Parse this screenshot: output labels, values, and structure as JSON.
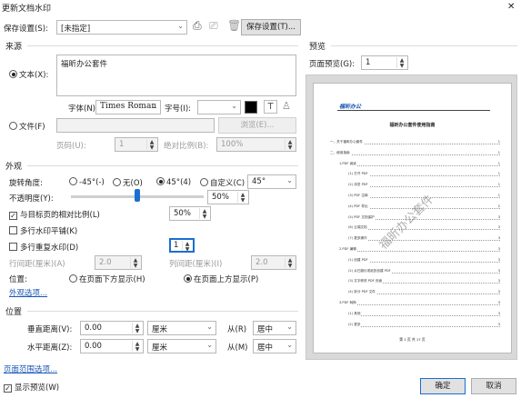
{
  "window": {
    "title": "更新文档水印",
    "close": "✕"
  },
  "saved": {
    "label": "保存设置(S):",
    "value": "[未指定]",
    "save_button": "保存设置(T)..."
  },
  "source": {
    "section": "来源",
    "text_radio": "文本(X):",
    "text_value": "福昕办公套件",
    "font_label": "字体(N):",
    "font_value": "Times Roman",
    "size_label": "字号(I):",
    "size_value": "",
    "file_radio": "文件(F)",
    "browse_button": "浏览(E)...",
    "page_label": "页码(U):",
    "page_value": "1",
    "abs_scale_label": "绝对比例(B):",
    "abs_scale_value": "100%"
  },
  "appearance": {
    "section": "外观",
    "rotation_label": "旋转角度:",
    "rot_options": [
      "-45°(-)",
      "无(O)",
      "45°(4)",
      "自定义(C)"
    ],
    "rot_custom_value": "45°",
    "opacity_label": "不透明度(Y):",
    "opacity_value": "50%",
    "opacity_level": 0.5,
    "relative_label": "与目标页的相对比例(L)",
    "relative_value": "50%",
    "multi_flat": "多行水印平铺(K)",
    "multi_overlay": "多行重复水印(D)",
    "multi_value": "1",
    "row_gap_label": "行间距(厘米)(A)",
    "row_gap_value": "2.0",
    "col_gap_label": "列间距(厘米)(I)",
    "col_gap_value": "2.0",
    "position_label": "位置:",
    "pos_below": "在页面下方显示(H)",
    "pos_above": "在页面上方显示(P)",
    "more_link": "外观选项..."
  },
  "position": {
    "section": "位置",
    "vdist_label": "垂直距离(V):",
    "vdist_value": "0.00",
    "vunit": "厘米",
    "vfrom_label": "从(R)",
    "vfrom_value": "居中",
    "hdist_label": "水平距离(Z):",
    "hdist_value": "0.00",
    "hunit": "厘米",
    "hfrom_label": "从(M)",
    "hfrom_value": "居中"
  },
  "page_range_link": "页面范围选项...",
  "show_preview": "显示预览(W)",
  "preview": {
    "section": "预览",
    "page_label": "页面预览(G):",
    "page_value": "1",
    "doc": {
      "logo": "福昕办公",
      "title": "福昕办公套件使用指南",
      "watermark": "福昕办公套件",
      "footer": "第 1 页 共 17 页",
      "toc": [
        {
          "t": "一、关于福昕办公套件",
          "p": "1",
          "lv": 0
        },
        {
          "t": "二、使用指南",
          "p": "1",
          "lv": 0
        },
        {
          "t": "1.PDF 阅读",
          "p": "1",
          "lv": 1
        },
        {
          "t": "(1) 打开 PDF",
          "p": "1",
          "lv": 2
        },
        {
          "t": "(2) 浏览 PDF",
          "p": "1",
          "lv": 2
        },
        {
          "t": "(3) PDF 注释",
          "p": "1",
          "lv": 2
        },
        {
          "t": "(4) PDF 导出",
          "p": "2",
          "lv": 2
        },
        {
          "t": "(5) PDF 文档保护",
          "p": "3",
          "lv": 2
        },
        {
          "t": "(6) 云端文档",
          "p": "3",
          "lv": 2
        },
        {
          "t": "(7) 更多操作",
          "p": "3",
          "lv": 2
        },
        {
          "t": "2.PDF 编辑",
          "p": "3",
          "lv": 1
        },
        {
          "t": "(1) 创建 PDF",
          "p": "3",
          "lv": 2
        },
        {
          "t": "(2) 从扫描仪或纸张创建 PDF",
          "p": "3",
          "lv": 2
        },
        {
          "t": "(3) 文字修改 PDF 页面",
          "p": "3",
          "lv": 2
        },
        {
          "t": "(4) 拆分 PDF 文件",
          "p": "3",
          "lv": 2
        },
        {
          "t": "3.PDF 转换",
          "p": "3",
          "lv": 1
        },
        {
          "t": "(1) 其他",
          "p": "3",
          "lv": 2
        },
        {
          "t": "(2) 更多",
          "p": "3",
          "lv": 2
        }
      ]
    }
  },
  "ok_button": "确定",
  "cancel_button": "取消"
}
